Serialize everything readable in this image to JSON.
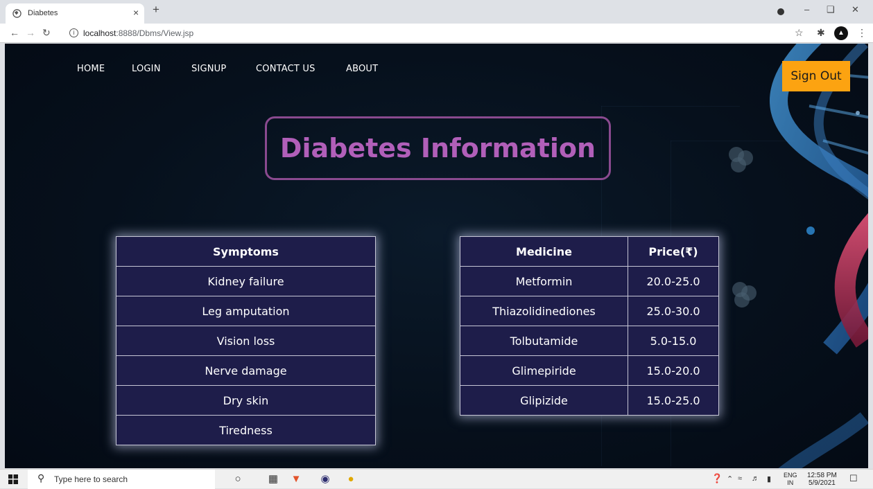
{
  "browser": {
    "tab_title": "Diabetes",
    "url_host": "localhost",
    "url_rest": ":8888/Dbms/View.jsp",
    "new_tab": "+",
    "tab_close": "×"
  },
  "nav": {
    "items": [
      "HOME",
      "LOGIN",
      "SIGNUP",
      "CONTACT US",
      "ABOUT"
    ],
    "sign_out": "Sign Out"
  },
  "headline": "Diabetes Information",
  "symptoms": {
    "header": "Symptoms",
    "rows": [
      "Kidney failure",
      "Leg amputation",
      "Vision loss",
      "Nerve damage",
      "Dry skin",
      "Tiredness"
    ]
  },
  "medicines": {
    "headers": [
      "Medicine",
      "Price(₹)"
    ],
    "rows": [
      {
        "name": "Metformin",
        "price": "20.0-25.0"
      },
      {
        "name": "Thiazolidinediones",
        "price": "25.0-30.0"
      },
      {
        "name": "Tolbutamide",
        "price": "5.0-15.0"
      },
      {
        "name": "Glimepiride",
        "price": "15.0-20.0"
      },
      {
        "name": "Glipizide",
        "price": "15.0-25.0"
      }
    ]
  },
  "taskbar": {
    "search_placeholder": "Type here to search",
    "lang_top": "ENG",
    "lang_bottom": "IN",
    "time": "12:58 PM",
    "date": "5/9/2021"
  },
  "colors": {
    "sign_out_bg": "#fca311",
    "headline": "#b15fb9",
    "table_bg": "#1e1d4a"
  }
}
